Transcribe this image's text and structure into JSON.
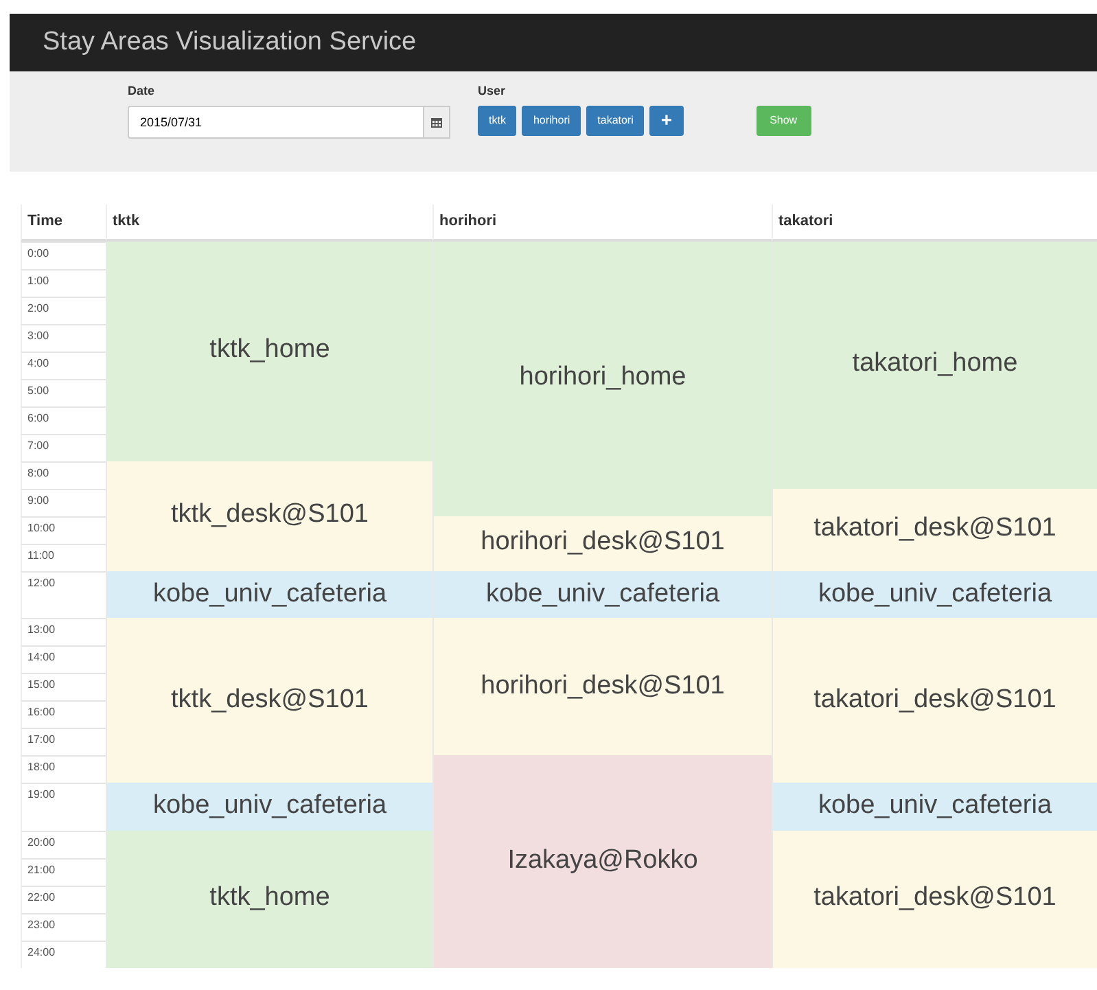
{
  "navbar": {
    "title": "Stay Areas Visualization Service"
  },
  "form": {
    "date_label": "Date",
    "date_value": "2015/07/31",
    "user_label": "User",
    "users": [
      "tktk",
      "horihori",
      "takatori"
    ],
    "add_button": "+",
    "show_button": "Show"
  },
  "table": {
    "time_column": {
      "header": "Time",
      "times": [
        "0:00",
        "1:00",
        "2:00",
        "3:00",
        "4:00",
        "5:00",
        "6:00",
        "7:00",
        "8:00",
        "9:00",
        "10:00",
        "11:00",
        "12:00",
        "13:00",
        "14:00",
        "15:00",
        "16:00",
        "17:00",
        "18:00",
        "19:00",
        "20:00",
        "21:00",
        "22:00",
        "23:00",
        "24:00"
      ]
    },
    "user_columns": [
      {
        "header": "tktk",
        "cells": [
          {
            "label": "tktk_home",
            "kind": "home"
          },
          null,
          null,
          null,
          null,
          null,
          null,
          null,
          {
            "label": "tktk_desk@S101",
            "kind": "desk"
          },
          null,
          null,
          null,
          {
            "label": "kobe_univ_cafeteria",
            "kind": "cafeteria"
          },
          {
            "label": "tktk_desk@S101",
            "kind": "desk"
          },
          null,
          null,
          null,
          null,
          null,
          {
            "label": "kobe_univ_cafeteria",
            "kind": "cafeteria"
          },
          {
            "label": "tktk_home",
            "kind": "home"
          },
          null,
          null,
          null,
          null
        ]
      },
      {
        "header": "horihori",
        "cells": [
          {
            "label": "horihori_home",
            "kind": "home"
          },
          null,
          null,
          null,
          null,
          null,
          null,
          null,
          null,
          null,
          {
            "label": "horihori_desk@S101",
            "kind": "desk"
          },
          null,
          {
            "label": "kobe_univ_cafeteria",
            "kind": "cafeteria"
          },
          {
            "label": "horihori_desk@S101",
            "kind": "desk"
          },
          null,
          null,
          null,
          null,
          {
            "label": "Izakaya@Rokko",
            "kind": "bar"
          },
          null,
          null,
          null,
          null,
          null,
          null
        ]
      },
      {
        "header": "takatori",
        "cells": [
          {
            "label": "takatori_home",
            "kind": "home"
          },
          null,
          null,
          null,
          null,
          null,
          null,
          null,
          null,
          {
            "label": "takatori_desk@S101",
            "kind": "desk"
          },
          null,
          null,
          {
            "label": "kobe_univ_cafeteria",
            "kind": "cafeteria"
          },
          {
            "label": "takatori_desk@S101",
            "kind": "desk"
          },
          null,
          null,
          null,
          null,
          null,
          {
            "label": "kobe_univ_cafeteria",
            "kind": "cafeteria"
          },
          {
            "label": "takatori_desk@S101",
            "kind": "desk"
          },
          null,
          null,
          null,
          null
        ]
      }
    ]
  }
}
